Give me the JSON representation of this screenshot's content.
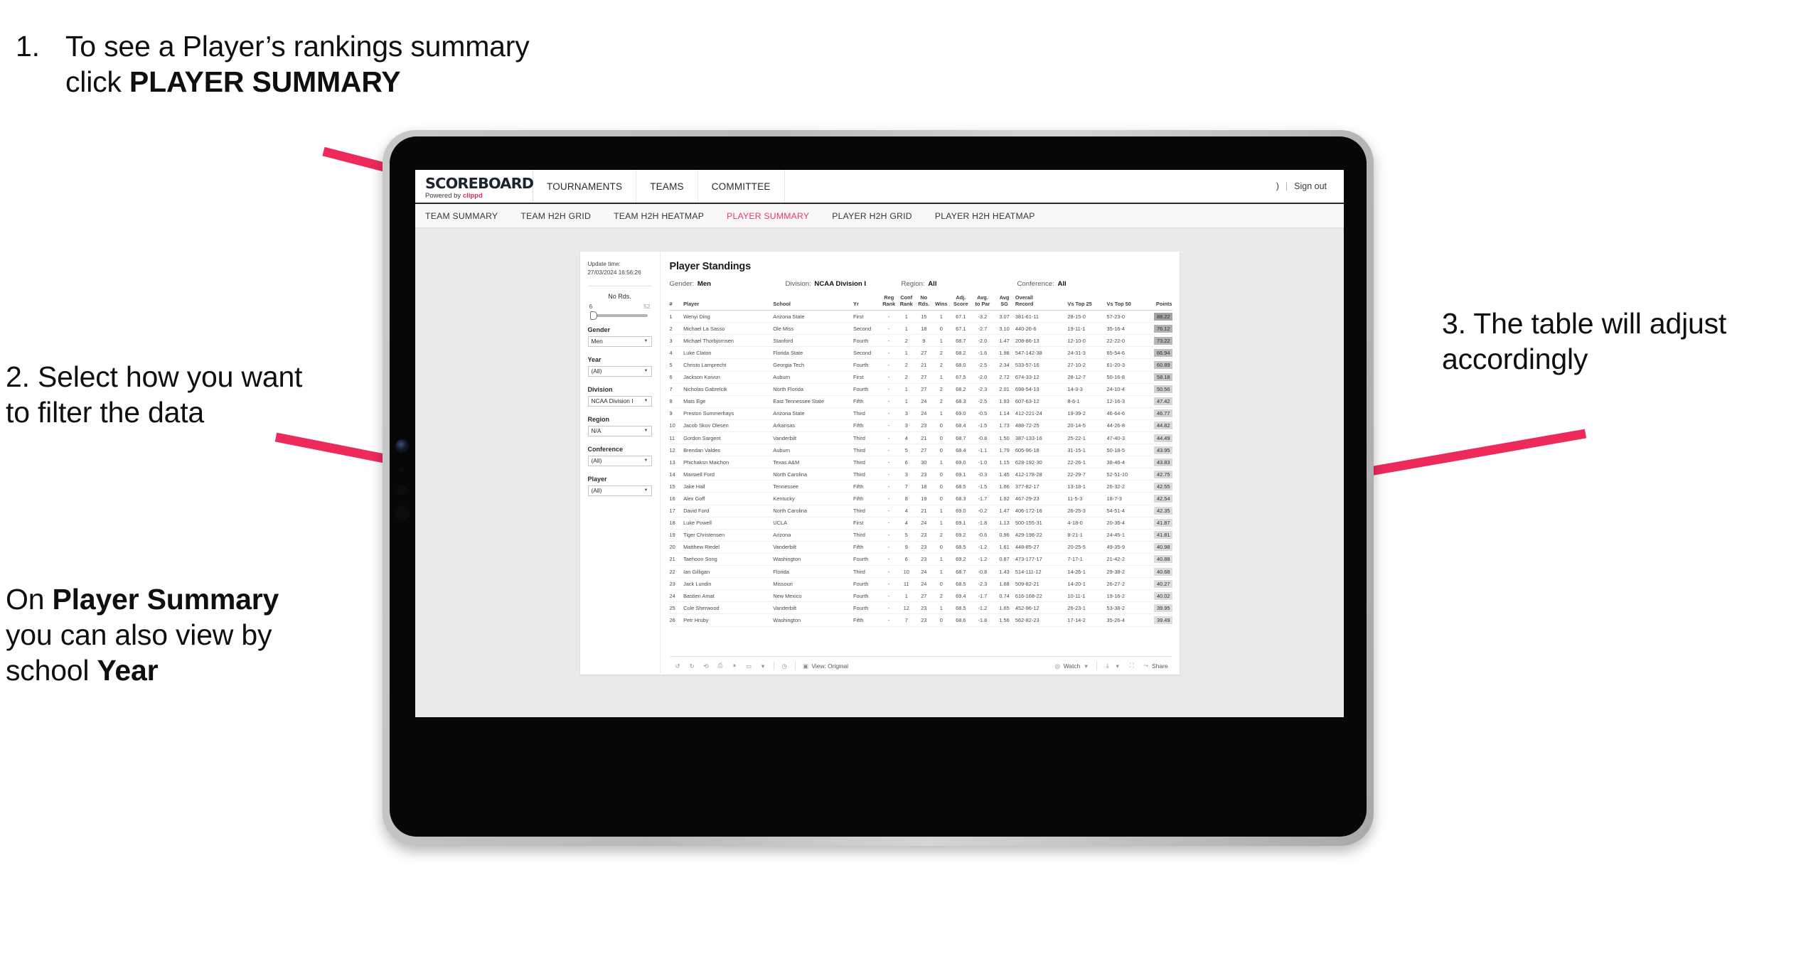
{
  "annotations": {
    "step1": {
      "number": "1.",
      "text_before": "To see a Player’s rankings summary click ",
      "bold": "PLAYER SUMMARY"
    },
    "step2": {
      "text": "2. Select how you want to filter the data"
    },
    "step2b": {
      "lead": "On ",
      "bold1": "Player Summary",
      "mid": " you can also view by school ",
      "bold2": "Year"
    },
    "step3": {
      "text": "3. The table will adjust accordingly"
    },
    "accent_color": "#ee2a5c"
  },
  "app": {
    "brand": {
      "name": "SCOREBOARD",
      "powered_prefix": "Powered by ",
      "powered_brand": "clippd"
    },
    "top_nav": [
      "TOURNAMENTS",
      "TEAMS",
      "COMMITTEE"
    ],
    "top_right": {
      "user": ")",
      "separator": "|",
      "sign_out": "Sign out"
    },
    "sub_nav": [
      {
        "label": "TEAM SUMMARY",
        "active": false
      },
      {
        "label": "TEAM H2H GRID",
        "active": false
      },
      {
        "label": "TEAM H2H HEATMAP",
        "active": false
      },
      {
        "label": "PLAYER SUMMARY",
        "active": true
      },
      {
        "label": "PLAYER H2H GRID",
        "active": false
      },
      {
        "label": "PLAYER H2H HEATMAP",
        "active": false
      }
    ],
    "active_tab_color": "#ea3a68"
  },
  "filters": {
    "update_label": "Update time:",
    "update_value": "27/03/2024 16:56:26",
    "no_rds": {
      "label": "No Rds.",
      "min": "6",
      "max": "52"
    },
    "fields": [
      {
        "label": "Gender",
        "value": "Men"
      },
      {
        "label": "Year",
        "value": "(All)"
      },
      {
        "label": "Division",
        "value": "NCAA Division I"
      },
      {
        "label": "Region",
        "value": "N/A"
      },
      {
        "label": "Conference",
        "value": "(All)"
      },
      {
        "label": "Player",
        "value": "(All)"
      }
    ]
  },
  "dashboard": {
    "title": "Player Standings",
    "crumbs": [
      {
        "label": "Gender: ",
        "value": "Men"
      },
      {
        "label": "Division: ",
        "value": "NCAA Division I"
      },
      {
        "label": "Region: ",
        "value": "All"
      },
      {
        "label": "Conference: ",
        "value": "All"
      }
    ],
    "columns": [
      "#",
      "Player",
      "School",
      "Yr",
      "Reg Rank",
      "Conf Rank",
      "No Rds.",
      "Wins",
      "Adj. Score",
      "Avg. to Par",
      "Avg SG",
      "Overall Record",
      "Vs Top 25",
      "Vs Top 50",
      "Points"
    ],
    "columns_wrapped": [
      [
        "#"
      ],
      [
        "Player"
      ],
      [
        "School"
      ],
      [
        "Yr"
      ],
      [
        "Reg",
        "Rank"
      ],
      [
        "Conf",
        "Rank"
      ],
      [
        "No",
        "Rds."
      ],
      [
        "Wins"
      ],
      [
        "Adj.",
        "Score"
      ],
      [
        "Avg.",
        "to Par"
      ],
      [
        "Avg",
        "SG"
      ],
      [
        "Overall",
        "Record"
      ],
      [
        "Vs Top 25"
      ],
      [
        "Vs Top 50"
      ],
      [
        "Points"
      ]
    ],
    "rows": [
      [
        "1",
        "Wenyi Ding",
        "Arizona State",
        "First",
        "-",
        "1",
        "15",
        "1",
        "67.1",
        "-3.2",
        "3.07",
        "381-61-11",
        "28-15-0",
        "57-23-0",
        "88.22"
      ],
      [
        "2",
        "Michael La Sasso",
        "Ole Miss",
        "Second",
        "-",
        "1",
        "18",
        "0",
        "67.1",
        "-2.7",
        "3.10",
        "440-26-6",
        "19-11-1",
        "35-16-4",
        "76.12"
      ],
      [
        "3",
        "Michael Thorbjornsen",
        "Stanford",
        "Fourth",
        "-",
        "2",
        "9",
        "1",
        "68.7",
        "-2.0",
        "1.47",
        "208-86-13",
        "12-10-0",
        "22-22-0",
        "73.22"
      ],
      [
        "4",
        "Luke Claton",
        "Florida State",
        "Second",
        "-",
        "1",
        "27",
        "2",
        "68.2",
        "-1.6",
        "1.98",
        "547-142-38",
        "24-31-3",
        "65-54-6",
        "66.94"
      ],
      [
        "5",
        "Christo Lamprecht",
        "Georgia Tech",
        "Fourth",
        "-",
        "2",
        "21",
        "2",
        "68.0",
        "-2.5",
        "2.34",
        "533-57-16",
        "27-10-2",
        "61-20-3",
        "60.89"
      ],
      [
        "6",
        "Jackson Koivun",
        "Auburn",
        "First",
        "-",
        "2",
        "27",
        "1",
        "67.5",
        "-2.0",
        "2.72",
        "674-33-12",
        "28-12-7",
        "50-16-8",
        "58.18"
      ],
      [
        "7",
        "Nicholas Gabrelcik",
        "North Florida",
        "Fourth",
        "-",
        "1",
        "27",
        "2",
        "68.2",
        "-2.3",
        "2.01",
        "698-54-13",
        "14-3-3",
        "24-10-4",
        "50.56"
      ],
      [
        "8",
        "Mats Ege",
        "East Tennessee State",
        "Fifth",
        "-",
        "1",
        "24",
        "2",
        "68.3",
        "-2.5",
        "1.93",
        "607-63-12",
        "8-6-1",
        "12-16-3",
        "47.42"
      ],
      [
        "9",
        "Preston Summerhays",
        "Arizona State",
        "Third",
        "-",
        "3",
        "24",
        "1",
        "69.0",
        "-0.5",
        "1.14",
        "412-221-24",
        "19-39-2",
        "46-64-6",
        "46.77"
      ],
      [
        "10",
        "Jacob Skov Olesen",
        "Arkansas",
        "Fifth",
        "-",
        "3",
        "23",
        "0",
        "68.4",
        "-1.5",
        "1.73",
        "488-72-25",
        "20-14-5",
        "44-26-8",
        "44.82"
      ],
      [
        "11",
        "Gordon Sargent",
        "Vanderbilt",
        "Third",
        "-",
        "4",
        "21",
        "0",
        "68.7",
        "-0.8",
        "1.50",
        "387-133-16",
        "25-22-1",
        "47-40-3",
        "44.49"
      ],
      [
        "12",
        "Brendan Valdes",
        "Auburn",
        "Third",
        "-",
        "5",
        "27",
        "0",
        "68.4",
        "-1.1",
        "1.79",
        "605-96-18",
        "31-15-1",
        "50-18-5",
        "43.95"
      ],
      [
        "13",
        "Phichaksn Maichon",
        "Texas A&M",
        "Third",
        "-",
        "6",
        "30",
        "1",
        "69.0",
        "-1.0",
        "1.15",
        "628-192-30",
        "22-26-1",
        "38-46-4",
        "43.83"
      ],
      [
        "14",
        "Maxwell Ford",
        "North Carolina",
        "Third",
        "-",
        "3",
        "23",
        "0",
        "69.1",
        "-0.3",
        "1.45",
        "412-178-28",
        "22-29-7",
        "52-51-10",
        "42.75"
      ],
      [
        "15",
        "Jake Hall",
        "Tennessee",
        "Fifth",
        "-",
        "7",
        "18",
        "0",
        "68.5",
        "-1.5",
        "1.66",
        "377-82-17",
        "13-18-1",
        "26-32-2",
        "42.55"
      ],
      [
        "16",
        "Alex Goff",
        "Kentucky",
        "Fifth",
        "-",
        "8",
        "19",
        "0",
        "68.3",
        "-1.7",
        "1.92",
        "467-29-23",
        "11-5-3",
        "18-7-3",
        "42.54"
      ],
      [
        "17",
        "David Ford",
        "North Carolina",
        "Third",
        "-",
        "4",
        "21",
        "1",
        "69.0",
        "-0.2",
        "1.47",
        "406-172-16",
        "26-25-3",
        "54-51-4",
        "42.35"
      ],
      [
        "18",
        "Luke Powell",
        "UCLA",
        "First",
        "-",
        "4",
        "24",
        "1",
        "69.1",
        "-1.8",
        "1.13",
        "500-155-31",
        "4-18-0",
        "20-36-4",
        "41.87"
      ],
      [
        "19",
        "Tiger Christensen",
        "Arizona",
        "Third",
        "-",
        "5",
        "23",
        "2",
        "69.2",
        "-0.6",
        "0.96",
        "429-198-22",
        "8-21-1",
        "24-45-1",
        "41.81"
      ],
      [
        "20",
        "Matthew Riedel",
        "Vanderbilt",
        "Fifth",
        "-",
        "9",
        "23",
        "0",
        "68.5",
        "-1.2",
        "1.61",
        "448-85-27",
        "20-25-5",
        "49-35-9",
        "40.98"
      ],
      [
        "21",
        "Taehoon Song",
        "Washington",
        "Fourth",
        "-",
        "6",
        "23",
        "1",
        "69.2",
        "-1.2",
        "0.87",
        "473-177-17",
        "7-17-1",
        "21-42-2",
        "40.88"
      ],
      [
        "22",
        "Ian Gilligan",
        "Florida",
        "Third",
        "-",
        "10",
        "24",
        "1",
        "68.7",
        "-0.8",
        "1.43",
        "514-111-12",
        "14-26-1",
        "29-38-2",
        "40.68"
      ],
      [
        "23",
        "Jack Lundin",
        "Missouri",
        "Fourth",
        "-",
        "11",
        "24",
        "0",
        "68.5",
        "-2.3",
        "1.68",
        "509-82-21",
        "14-20-1",
        "26-27-2",
        "40.27"
      ],
      [
        "24",
        "Bastien Amat",
        "New Mexico",
        "Fourth",
        "-",
        "1",
        "27",
        "2",
        "69.4",
        "-1.7",
        "0.74",
        "616-168-22",
        "10-11-1",
        "19-16-2",
        "40.02"
      ],
      [
        "25",
        "Cole Sherwood",
        "Vanderbilt",
        "Fourth",
        "-",
        "12",
        "23",
        "1",
        "68.5",
        "-1.2",
        "1.65",
        "452-96-12",
        "26-23-1",
        "53-38-2",
        "39.95"
      ],
      [
        "26",
        "Petr Hruby",
        "Washington",
        "Fifth",
        "-",
        "7",
        "23",
        "0",
        "68.6",
        "-1.8",
        "1.56",
        "562-82-23",
        "17-14-2",
        "35-26-4",
        "39.49"
      ]
    ]
  },
  "toolbar": {
    "view_label": "View: Original",
    "watch_label": "Watch",
    "share_label": "Share"
  }
}
